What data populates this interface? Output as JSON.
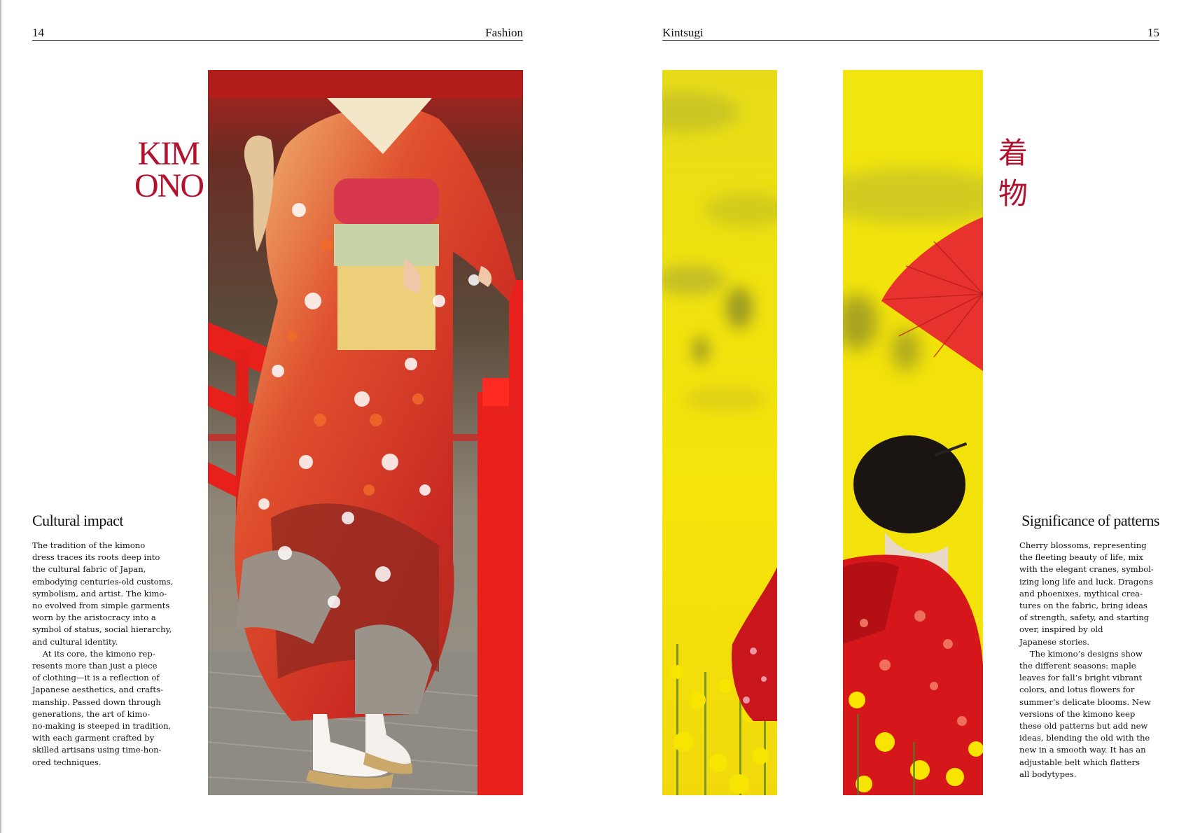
{
  "colors": {
    "accent": "#b3122e",
    "yellow": "#f2e10a",
    "red": "#d8131a"
  },
  "left_page": {
    "page_number": "14",
    "section": "Fashion",
    "title_line1": "KIM",
    "title_line2": "ONO",
    "heading": "Cultural impact",
    "body": "The tradition of the kimono\ndress traces its roots deep into\nthe cultural fabric of Japan,\nembodying centuries-old customs,\nsymbolism, and artist. The kimo-\nno evolved from simple garments\nworn by the aristocracy into a\nsymbol of status, social hierarchy,\nand cultural identity.\n    At its core, the kimono rep-\nresents more than just a piece\nof clothing—it is a reflection of\nJapanese aesthetics, and crafts-\nmanship. Passed down through\ngenerations, the art of kimo-\nno-making is steeped in tradition,\nwith each garment crafted by\nskilled artisans using time-hon-\nored techniques."
  },
  "right_page": {
    "page_number": "15",
    "section": "Kintsugi",
    "kanji1": "着",
    "kanji2": "物",
    "heading": "Significance of patterns",
    "body": "Cherry blossoms, representing\nthe fleeting beauty of life, mix\nwith the elegant cranes, symbol-\nizing long life and luck. Dragons\nand phoenixes, mythical crea-\ntures on the fabric, bring ideas\nof strength, safety, and starting\nover, inspired by old\nJapanese stories.\n    The kimono’s designs show\nthe different seasons: maple\nleaves for fall’s bright vibrant\ncolors, and lotus flowers for\nsummer’s delicate blooms. New\nversions of the kimono keep\nthese old patterns but add new\nideas, blending the old with the\nnew in a smooth way. It has an\nadjustable belt which flatters\nall bodytypes."
  }
}
